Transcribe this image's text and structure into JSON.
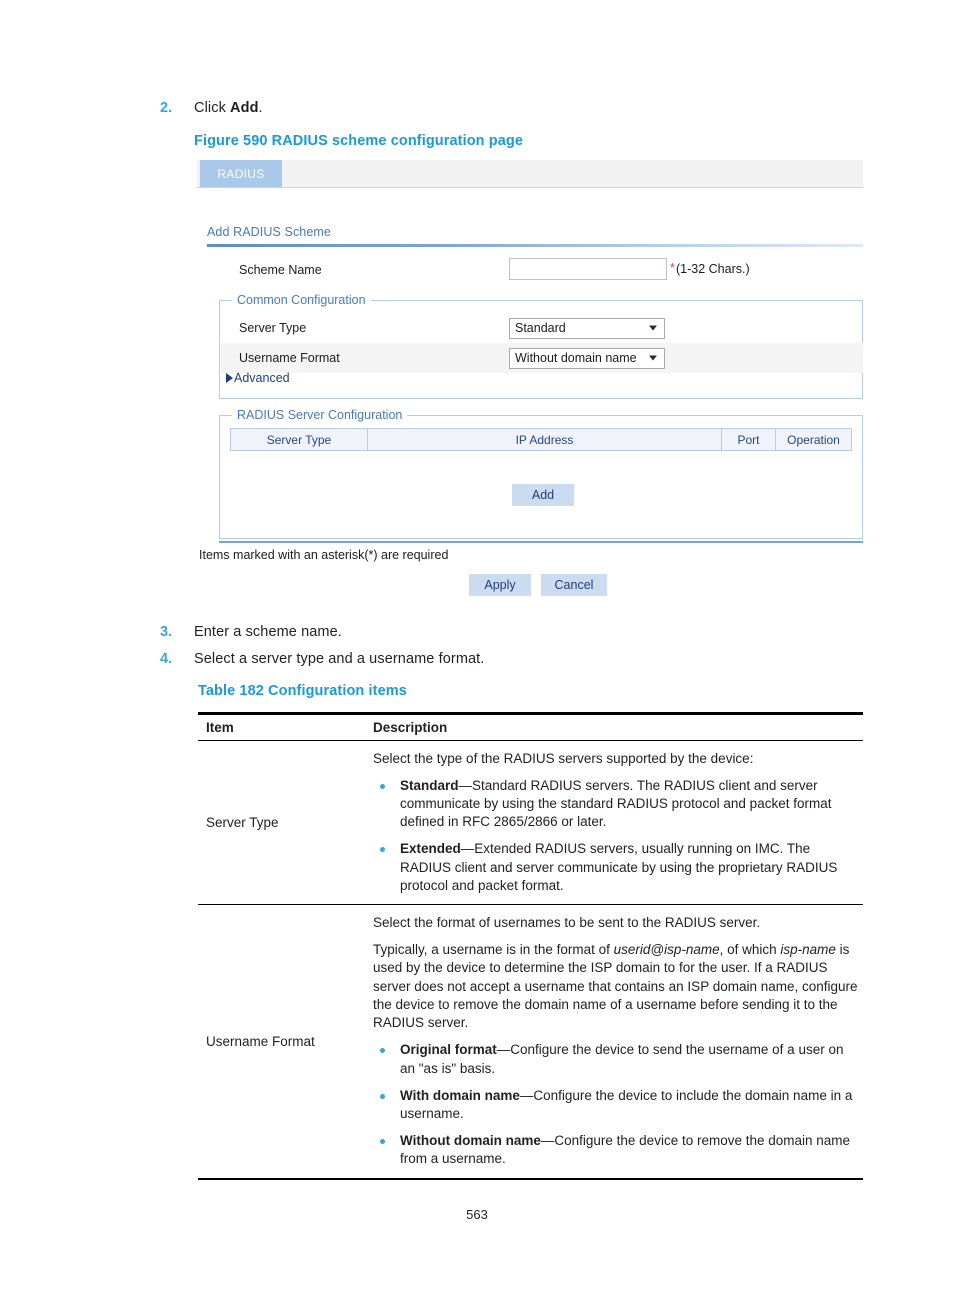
{
  "steps": [
    {
      "num": "2.",
      "text_before": "Click ",
      "bold": "Add",
      "text_after": "."
    },
    {
      "num": "3.",
      "text": "Enter a scheme name."
    },
    {
      "num": "4.",
      "text": "Select a server type and a username format."
    }
  ],
  "figure_caption": "Figure 590 RADIUS scheme configuration page",
  "table_caption": "Table 182 Configuration items",
  "figure": {
    "tab_label": "RADIUS",
    "heading": "Add RADIUS Scheme",
    "scheme_name": {
      "label": "Scheme Name",
      "value": "",
      "placeholder": "",
      "required_marker": "*",
      "hint": "(1-32 Chars.)"
    },
    "common_configuration": {
      "legend": "Common Configuration",
      "server_type": {
        "label": "Server Type",
        "selected": "Standard",
        "options": [
          "Standard",
          "Extended"
        ]
      },
      "username_format": {
        "label": "Username Format",
        "selected": "Without domain name",
        "options": [
          "Original format",
          "With domain name",
          "Without domain name"
        ]
      },
      "advanced_label": "Advanced"
    },
    "server_configuration": {
      "legend": "RADIUS Server Configuration",
      "columns": [
        "Server Type",
        "IP Address",
        "Port",
        "Operation"
      ],
      "rows": [],
      "add_button": "Add"
    },
    "asterisk_note": "Items marked with an asterisk(*) are required",
    "apply_button": "Apply",
    "cancel_button": "Cancel",
    "colors": {
      "tab_active": "#a9c8ea",
      "heading_blue": "#4b7ab5",
      "button_blue": "#ccdcf0",
      "required_red": "#e8403a"
    }
  },
  "config_table": {
    "headers": [
      "Item",
      "Description"
    ],
    "rows": [
      {
        "item": "Server Type",
        "intro": "Select the type of the RADIUS servers supported by the device:",
        "bullets": [
          {
            "term": "Standard",
            "dash": "—",
            "desc": "Standard RADIUS servers. The RADIUS client and server communicate by using the standard RADIUS protocol and packet format defined in RFC 2865/2866 or later."
          },
          {
            "term": "Extended",
            "dash": "—",
            "desc": "Extended RADIUS servers, usually running on IMC. The RADIUS client and server communicate by using the proprietary RADIUS protocol and packet format."
          }
        ]
      },
      {
        "item": "Username Format",
        "intro": "Select the format of usernames to be sent to the RADIUS server.",
        "para2_a": "Typically, a username is in the format of ",
        "para2_i1": "userid@isp-name",
        "para2_b": ", of which ",
        "para2_i2": "isp-name",
        "para2_c": " is used by the device to determine the ISP domain to for the user. If a RADIUS server does not accept a username that contains an ISP domain name, configure the device to remove the domain name of a username before sending it to the RADIUS server.",
        "bullets": [
          {
            "term": "Original format",
            "dash": "—",
            "desc": "Configure the device to send the username of a user on an \"as is\" basis."
          },
          {
            "term": "With domain name",
            "dash": "—",
            "desc": "Configure the device to include the domain name in a username."
          },
          {
            "term": "Without domain name",
            "dash": "—",
            "desc": "Configure the device to remove the domain name from a username."
          }
        ]
      }
    ]
  },
  "page_number": "563"
}
